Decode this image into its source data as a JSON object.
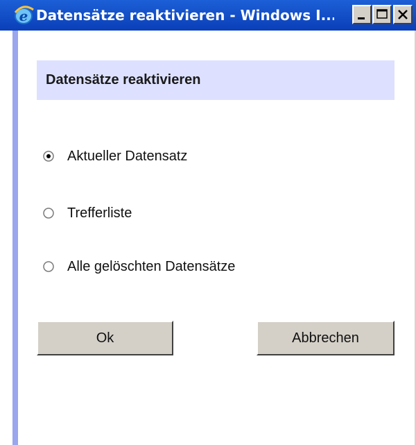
{
  "window": {
    "title": "Datensätze reaktivieren - Windows I...",
    "icon": "internet-explorer-icon",
    "controls": [
      "minimize-icon",
      "maximize-icon",
      "close-icon"
    ]
  },
  "dialog": {
    "heading": "Datensätze reaktivieren",
    "options": [
      {
        "label": "Aktueller Datensatz",
        "selected": true
      },
      {
        "label": "Trefferliste",
        "selected": false
      },
      {
        "label": "Alle gelöschten Datensätze",
        "selected": false
      }
    ],
    "buttons": {
      "ok_label": "Ok",
      "cancel_label": "Abbrechen"
    }
  },
  "colors": {
    "titlebar": "#0a3fb8",
    "header_panel": "#dde1ff",
    "accent_stripe": "#9aa6ee",
    "button_face": "#d4d0c8"
  }
}
